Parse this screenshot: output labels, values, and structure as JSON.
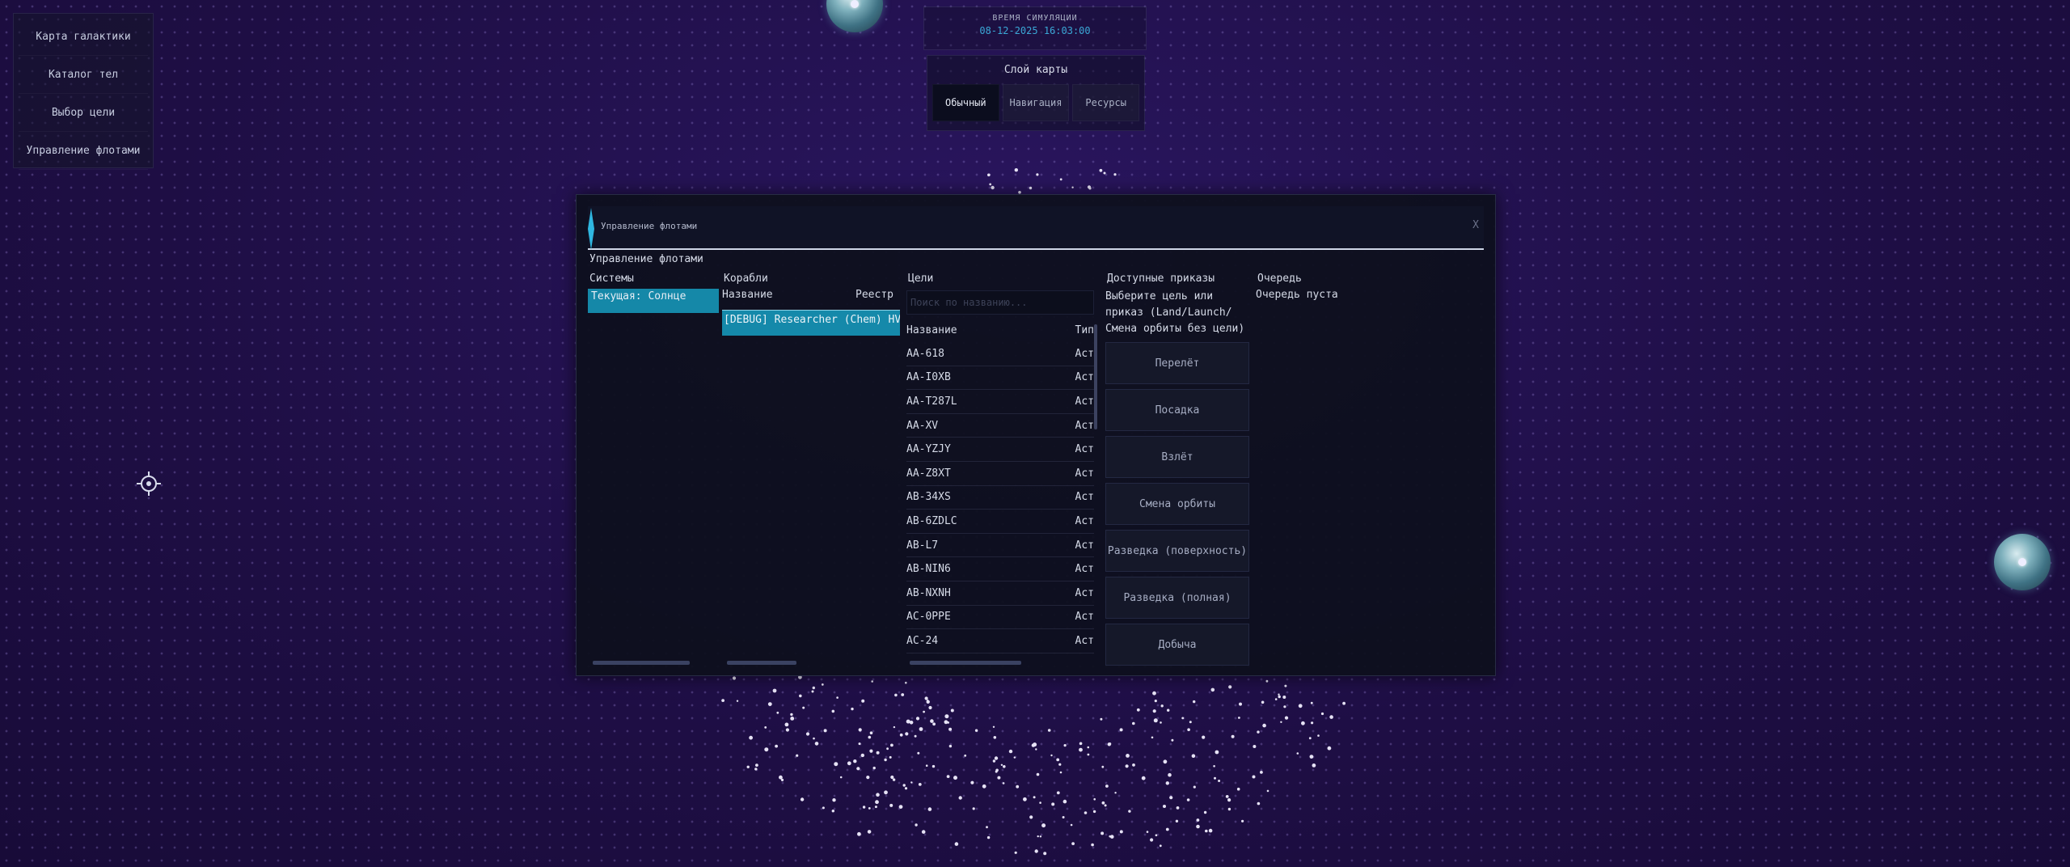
{
  "left_nav": {
    "items": [
      "Карта галактики",
      "Каталог тел",
      "Выбор цели",
      "Управление флотами"
    ]
  },
  "sim_time": {
    "label": "ВРЕМЯ СИМУЛЯЦИИ",
    "value": "08-12-2025 16:03:00"
  },
  "map_layer": {
    "title": "Слой карты",
    "tabs": [
      "Обычный",
      "Навигация",
      "Ресурсы"
    ],
    "active": "Обычный"
  },
  "modal": {
    "title": "Управление флотами",
    "close": "X",
    "subtitle": "Управление флотами",
    "systems": {
      "title": "Системы",
      "items": [
        "Текущая: Солнце"
      ]
    },
    "ships": {
      "title": "Корабли",
      "col_name": "Название",
      "col_registry": "Реестр",
      "items": [
        "[DEBUG] Researcher (Chem) HVE-"
      ]
    },
    "targets": {
      "title": "Цели",
      "search_placeholder": "Поиск по названию...",
      "col_name": "Название",
      "col_type": "Тип",
      "rows": [
        {
          "name": "AA-618",
          "type": "Аст"
        },
        {
          "name": "AA-I0XB",
          "type": "Аст"
        },
        {
          "name": "AA-T287L",
          "type": "Аст"
        },
        {
          "name": "AA-XV",
          "type": "Аст"
        },
        {
          "name": "AA-YZJY",
          "type": "Аст"
        },
        {
          "name": "AA-Z8XT",
          "type": "Аст"
        },
        {
          "name": "AB-34XS",
          "type": "Аст"
        },
        {
          "name": "AB-6ZDLC",
          "type": "Аст"
        },
        {
          "name": "AB-L7",
          "type": "Аст"
        },
        {
          "name": "AB-NIN6",
          "type": "Аст"
        },
        {
          "name": "AB-NXNH",
          "type": "Аст"
        },
        {
          "name": "AC-0PPE",
          "type": "Аст"
        },
        {
          "name": "AC-24",
          "type": "Аст"
        }
      ]
    },
    "actions": {
      "title": "Доступные приказы",
      "hint": "Выберите цель или приказ (Land/Launch/ Смена орбиты без цели)",
      "buttons": [
        "Перелёт",
        "Посадка",
        "Взлёт",
        "Смена орбиты",
        "Разведка (поверхность)",
        "Разведка (полная)",
        "Добыча"
      ]
    },
    "queue": {
      "title": "Очередь",
      "empty": "Очередь пуста"
    }
  },
  "colors": {
    "accent": "#1588a8",
    "sim_time": "#3aa7d6",
    "background": "#1f0f45"
  }
}
